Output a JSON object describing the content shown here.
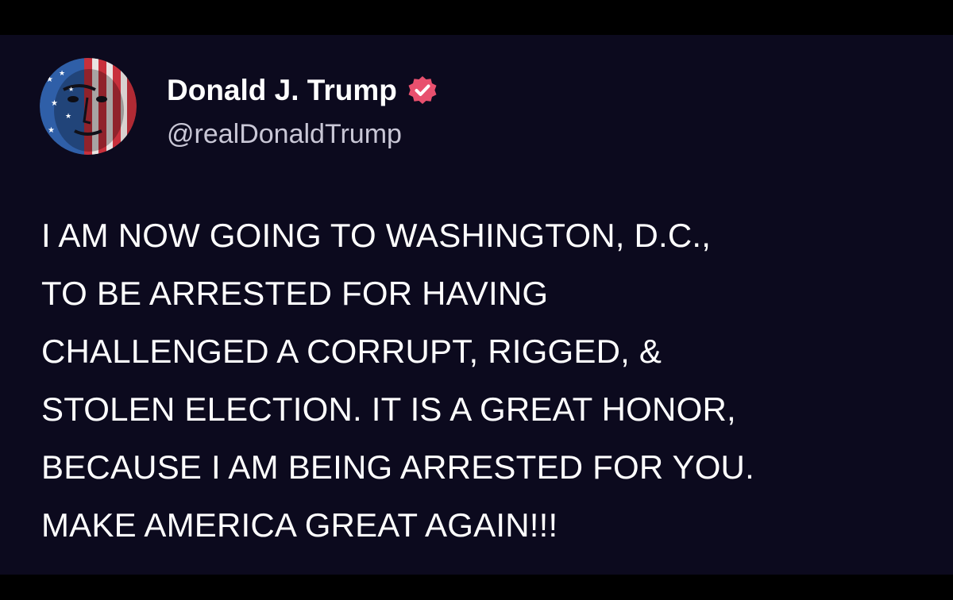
{
  "post": {
    "author": {
      "display_name": "Donald J. Trump",
      "handle": "@realDonaldTrump",
      "verified": true,
      "verified_icon": "verified-badge-icon",
      "avatar_icon": "flag-face-avatar"
    },
    "body_lines": [
      "I AM NOW GOING TO WASHINGTON, D.C.,",
      "TO BE ARRESTED FOR HAVING",
      "CHALLENGED A CORRUPT, RIGGED, &",
      "STOLEN ELECTION. IT IS A GREAT HONOR,",
      "BECAUSE I AM BEING ARRESTED FOR YOU.",
      "MAKE AMERICA GREAT AGAIN!!!"
    ]
  },
  "colors": {
    "background": "#0c0a1e",
    "frame": "#000000",
    "text_primary": "#ffffff",
    "text_secondary": "#c9c7d6",
    "verified_badge": "#e8506e"
  }
}
